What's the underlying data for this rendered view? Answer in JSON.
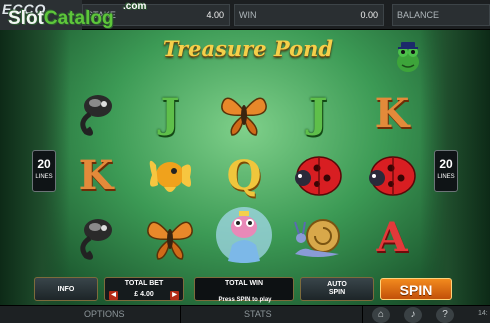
{
  "topbar": {
    "logo": "ECCO",
    "watermark_slot": "Slot",
    "watermark_catalog": "Catalog",
    "watermark_com": ".com",
    "stake_label": "STAKE",
    "stake_value": "4.00",
    "win_label": "WIN",
    "win_value": "0.00",
    "balance_label": "BALANCE",
    "balance_value": ""
  },
  "game": {
    "title": "Treasure Pond"
  },
  "reels": [
    [
      "tadpole",
      "K",
      "tadpole"
    ],
    [
      "J",
      "goldfish",
      "butterfly"
    ],
    [
      "butterfly",
      "Q",
      "frog-princess"
    ],
    [
      "J",
      "ladybird",
      "snail"
    ],
    [
      "K",
      "ladybird",
      "A"
    ]
  ],
  "lines": {
    "count": "20",
    "label": "LINES"
  },
  "controls": {
    "info_label": "INFO",
    "total_bet_label": "TOTAL BET",
    "total_bet_value": "£ 4.00",
    "total_win_label": "TOTAL WIN",
    "auto_spin_label_1": "AUTO",
    "auto_spin_label_2": "SPIN",
    "spin_label": "SPIN",
    "prompt": "Press SPIN to play"
  },
  "footer": {
    "options_label": "OPTIONS",
    "stats_label": "STATS",
    "clock": "14:"
  },
  "colors": {
    "spin_button": "#e06a14",
    "title_gold": "#f5d04a",
    "frame_gold": "#7d6b3c"
  }
}
